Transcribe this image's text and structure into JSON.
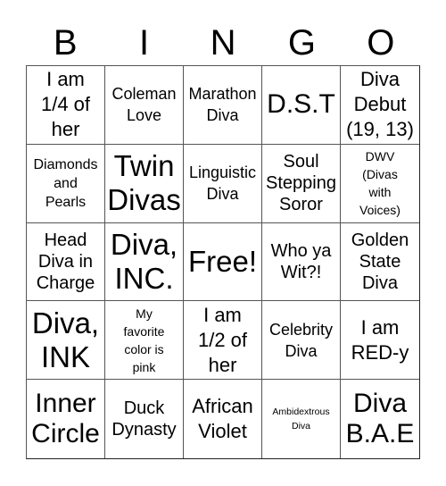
{
  "header": [
    "B",
    "I",
    "N",
    "G",
    "O"
  ],
  "cells": [
    {
      "text": "I am\n1/4 of\nher",
      "size": "s24"
    },
    {
      "text": "Coleman\nLove",
      "size": "s18"
    },
    {
      "text": "Marathon\nDiva",
      "size": "s18"
    },
    {
      "text": "D.S.T",
      "size": "s30"
    },
    {
      "text": "Diva\nDebut\n(19, 13)",
      "size": "s24"
    },
    {
      "text": "Diamonds\nand\nPearls",
      "size": "s16"
    },
    {
      "text": "Twin\nDivas",
      "size": "s36"
    },
    {
      "text": "Linguistic\nDiva",
      "size": "s18"
    },
    {
      "text": "Soul\nStepping\nSoror",
      "size": "s20"
    },
    {
      "text": "DWV\n(Divas\nwith\nVoices)",
      "size": "s14"
    },
    {
      "text": "Head\nDiva in\nCharge",
      "size": "s20"
    },
    {
      "text": "Diva,\nINC.",
      "size": "s36"
    },
    {
      "text": "Free!",
      "size": "s36"
    },
    {
      "text": "Who ya\nWit?!",
      "size": "s20"
    },
    {
      "text": "Golden\nState\nDiva",
      "size": "s20"
    },
    {
      "text": "Diva,\nINK",
      "size": "s36"
    },
    {
      "text": "My\nfavorite\ncolor is\npink",
      "size": "s14"
    },
    {
      "text": "I am\n1/2 of\nher",
      "size": "s24"
    },
    {
      "text": "Celebrity\nDiva",
      "size": "s18"
    },
    {
      "text": "I am\nRED-y",
      "size": "s24"
    },
    {
      "text": "Inner\nCircle",
      "size": "s30"
    },
    {
      "text": "Duck\nDynasty",
      "size": "s20"
    },
    {
      "text": "African\nViolet",
      "size": "s24"
    },
    {
      "text": "Ambidextrous\nDiva",
      "size": "s11"
    },
    {
      "text": "Diva\nB.A.E",
      "size": "s30"
    }
  ]
}
